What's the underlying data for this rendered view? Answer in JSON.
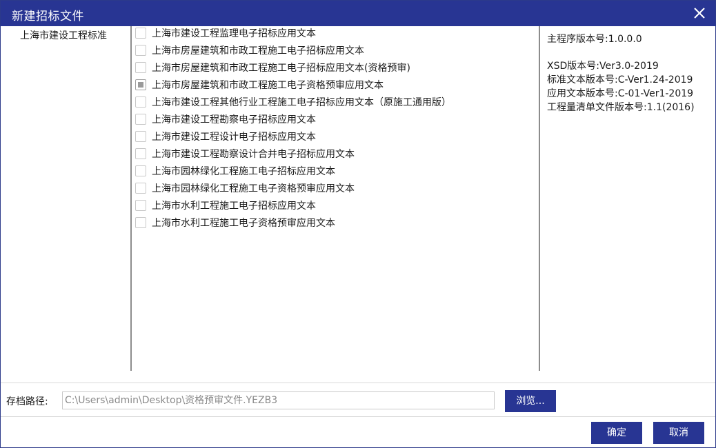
{
  "window": {
    "title": "新建招标文件"
  },
  "tree": {
    "items": [
      {
        "label": "上海市建设工程标准"
      }
    ]
  },
  "templates": [
    {
      "label": "上海市建设工程监理电子招标应用文本",
      "checked": false
    },
    {
      "label": "上海市房屋建筑和市政工程施工电子招标应用文本",
      "checked": false
    },
    {
      "label": "上海市房屋建筑和市政工程施工电子招标应用文本(资格预审)",
      "checked": false
    },
    {
      "label": "上海市房屋建筑和市政工程施工电子资格预审应用文本",
      "checked": true
    },
    {
      "label": "上海市建设工程其他行业工程施工电子招标应用文本（原施工通用版）",
      "checked": false
    },
    {
      "label": "上海市建设工程勘察电子招标应用文本",
      "checked": false
    },
    {
      "label": "上海市建设工程设计电子招标应用文本",
      "checked": false
    },
    {
      "label": "上海市建设工程勘察设计合并电子招标应用文本",
      "checked": false
    },
    {
      "label": "上海市园林绿化工程施工电子招标应用文本",
      "checked": false
    },
    {
      "label": "上海市园林绿化工程施工电子资格预审应用文本",
      "checked": false
    },
    {
      "label": "上海市水利工程施工电子招标应用文本",
      "checked": false
    },
    {
      "label": "上海市水利工程施工电子资格预审应用文本",
      "checked": false
    }
  ],
  "version_info": {
    "program": "主程序版本号:1.0.0.0",
    "xsd": "XSD版本号:Ver3.0-2019",
    "standard_text": "标准文本版本号:C-Ver1.24-2019",
    "application_text": "应用文本版本号:C-01-Ver1-2019",
    "bill_of_quantities": "工程量清单文件版本号:1.1(2016)"
  },
  "footer": {
    "path_label": "存档路径:",
    "path_value": "C:\\Users\\admin\\Desktop\\资格预审文件.YEZB3",
    "browse_label": "浏览...",
    "ok_label": "确定",
    "cancel_label": "取消"
  },
  "colors": {
    "accent": "#283593",
    "border": "#8c8c8c"
  },
  "icons": {
    "close": "close-icon",
    "checkbox": "checkbox"
  }
}
